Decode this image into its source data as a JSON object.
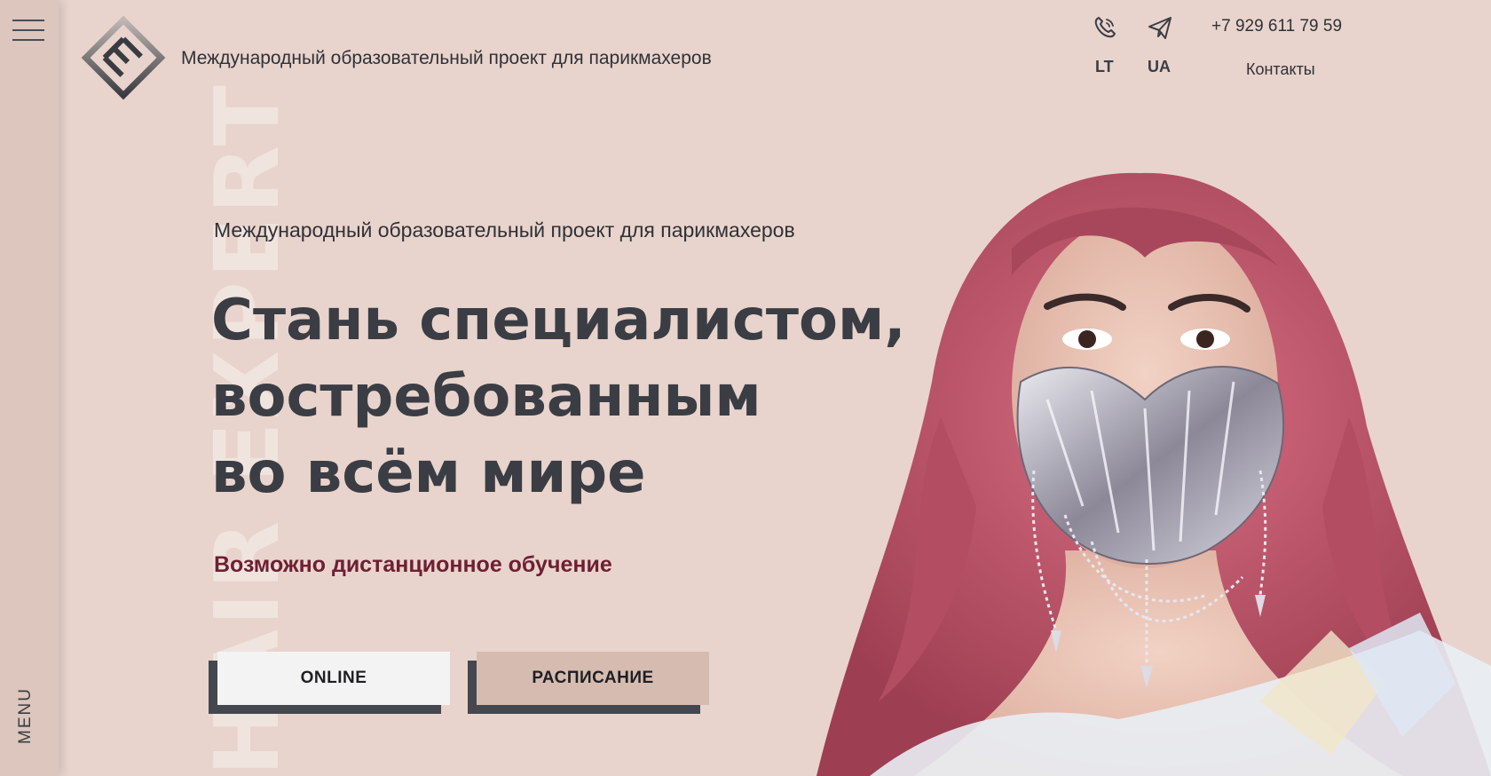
{
  "sidebar": {
    "menu_label": "MENU"
  },
  "watermark": "HAIR EXPERT",
  "header": {
    "tagline": "Международный образовательный проект для парикмахеров",
    "phone": "+7 929 611 79 59",
    "contacts": "Контакты",
    "languages": [
      "LT",
      "UA"
    ]
  },
  "hero": {
    "subtitle": "Международный образовательный проект для парикмахеров",
    "title_lines": [
      "Стань специалистом,",
      "востребованным",
      "во всём мире"
    ],
    "note": "Возможно дистанционное обучение",
    "buttons": {
      "online": "ONLINE",
      "schedule": "РАСПИСАНИЕ"
    }
  },
  "colors": {
    "background": "#e8d4cc",
    "sidebar": "#dcc6bd",
    "text_dark": "#3b3d44",
    "accent": "#6e1f33",
    "button_light": "#f4f3f3",
    "button_rose": "#d6bcb0",
    "hair": "#c0586c"
  },
  "icons": [
    "menu-icon",
    "phone-icon",
    "telegram-icon",
    "logo-icon"
  ]
}
